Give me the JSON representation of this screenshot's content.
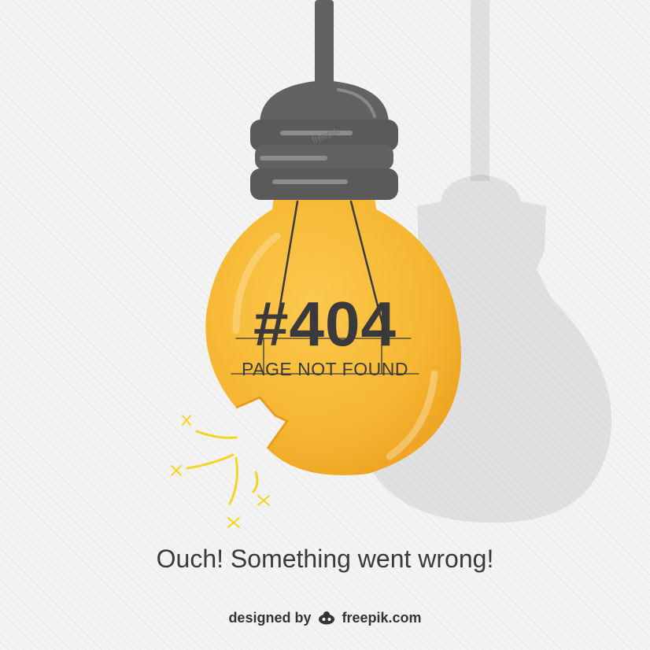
{
  "illustration": {
    "hashtag": "#404",
    "subtitle": "PAGE NOT FOUND",
    "icon": "lightbulb-icon",
    "colors": {
      "bulb": "#f6b732",
      "socket": "#626262",
      "text": "#3a3a3c",
      "spark": "#f5d422"
    }
  },
  "message": "Ouch! Something went wrong!",
  "credit": {
    "lead": "designed by",
    "logo_icon": "freepik-logo-icon",
    "brand": "freepik.com"
  }
}
